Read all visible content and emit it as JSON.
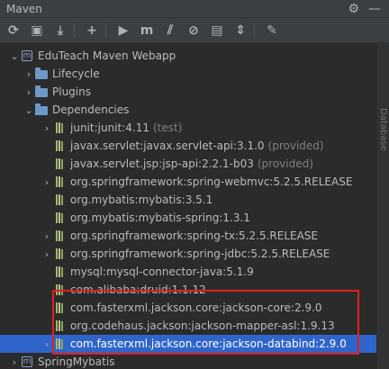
{
  "window": {
    "title": "Maven",
    "gear_icon": "gear-icon",
    "hide_icon": "minimize-icon"
  },
  "toolbar": {
    "buttons": [
      {
        "name": "reload-button",
        "glyph": "⟳"
      },
      {
        "name": "add-folder-button",
        "glyph": "▣"
      },
      {
        "name": "download-button",
        "glyph": "⤓"
      },
      {
        "name": "add-button",
        "glyph": "+"
      },
      {
        "name": "run-button",
        "glyph": "▶"
      },
      {
        "name": "execute-goal-button",
        "glyph": "m"
      },
      {
        "name": "toggle-offline-button",
        "glyph": "⫽"
      },
      {
        "name": "skip-tests-button",
        "glyph": "⊘"
      },
      {
        "name": "show-dependencies-button",
        "glyph": "▤"
      },
      {
        "name": "collapse-all-button",
        "glyph": "⇕"
      },
      {
        "name": "settings-wrench-button",
        "glyph": "✎"
      }
    ]
  },
  "tree": {
    "rows": [
      {
        "arrow": "v",
        "icon": "maven",
        "label": "EduTeach Maven Webapp",
        "extra": ""
      },
      {
        "arrow": ">",
        "icon": "folder",
        "label": "Lifecycle",
        "extra": ""
      },
      {
        "arrow": ">",
        "icon": "folder",
        "label": "Plugins",
        "extra": ""
      },
      {
        "arrow": "v",
        "icon": "folder",
        "label": "Dependencies",
        "extra": ""
      },
      {
        "arrow": ">",
        "icon": "lib",
        "label": "junit:junit:4.11",
        "extra": "(test)"
      },
      {
        "arrow": "",
        "icon": "lib",
        "label": "javax.servlet:javax.servlet-api:3.1.0",
        "extra": "(provided)"
      },
      {
        "arrow": "",
        "icon": "lib",
        "label": "javax.servlet.jsp:jsp-api:2.2.1-b03",
        "extra": "(provided)"
      },
      {
        "arrow": ">",
        "icon": "lib",
        "label": "org.springframework:spring-webmvc:5.2.5.RELEASE",
        "extra": ""
      },
      {
        "arrow": "",
        "icon": "lib",
        "label": "org.mybatis:mybatis:3.5.1",
        "extra": ""
      },
      {
        "arrow": "",
        "icon": "lib",
        "label": "org.mybatis:mybatis-spring:1.3.1",
        "extra": ""
      },
      {
        "arrow": ">",
        "icon": "lib",
        "label": "org.springframework:spring-tx:5.2.5.RELEASE",
        "extra": ""
      },
      {
        "arrow": ">",
        "icon": "lib",
        "label": "org.springframework:spring-jdbc:5.2.5.RELEASE",
        "extra": ""
      },
      {
        "arrow": "",
        "icon": "lib",
        "label": "mysql:mysql-connector-java:5.1.9",
        "extra": ""
      },
      {
        "arrow": "",
        "icon": "lib",
        "label": "com.alibaba:druid:1.1.12",
        "extra": ""
      },
      {
        "arrow": "",
        "icon": "lib",
        "label": "com.fasterxml.jackson.core:jackson-core:2.9.0",
        "extra": ""
      },
      {
        "arrow": "",
        "icon": "lib",
        "label": "org.codehaus.jackson:jackson-mapper-asl:1.9.13",
        "extra": ""
      },
      {
        "arrow": ">",
        "icon": "lib",
        "label": "com.fasterxml.jackson.core:jackson-databind:2.9.0",
        "extra": "",
        "selected": true
      },
      {
        "arrow": ">",
        "icon": "maven",
        "label": "SpringMybatis",
        "extra": ""
      }
    ]
  },
  "side_panel": {
    "label": "Database"
  },
  "colors": {
    "selection": "#2f65ca",
    "highlight_box": "#e22020",
    "library_icon": "#a2b870"
  }
}
